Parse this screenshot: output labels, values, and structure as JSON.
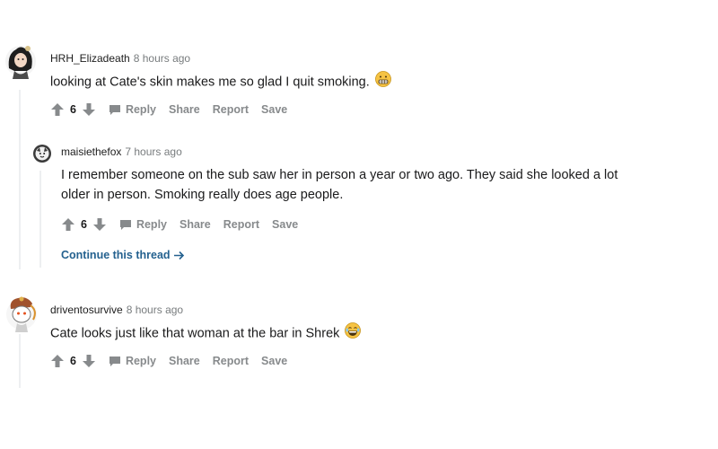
{
  "comments": [
    {
      "username": "HRH_Elizadeath",
      "time": "8 hours ago",
      "text": "looking at Cate's skin makes me so glad I quit smoking.",
      "emoji": "grimacing-face",
      "score": "6",
      "actions": {
        "reply": "Reply",
        "share": "Share",
        "report": "Report",
        "save": "Save"
      }
    },
    {
      "username": "maisiethefox",
      "time": "7 hours ago",
      "text_line1": "I remember someone on the sub saw her in person a year or two ago. They said she looked a lot",
      "text_line2": "older in person. Smoking really does age people.",
      "score": "6",
      "actions": {
        "reply": "Reply",
        "share": "Share",
        "report": "Report",
        "save": "Save"
      },
      "continue_label": "Continue this thread"
    },
    {
      "username": "driventosurvive",
      "time": "8 hours ago",
      "text": "Cate looks just like that woman at the bar in Shrek",
      "emoji": "laughing-face",
      "score": "6",
      "actions": {
        "reply": "Reply",
        "share": "Share",
        "report": "Report",
        "save": "Save"
      }
    }
  ],
  "colors": {
    "link": "#24618f",
    "muted": "#878a8c",
    "thread_line": "#edeff1",
    "text": "#1a1a1b"
  }
}
